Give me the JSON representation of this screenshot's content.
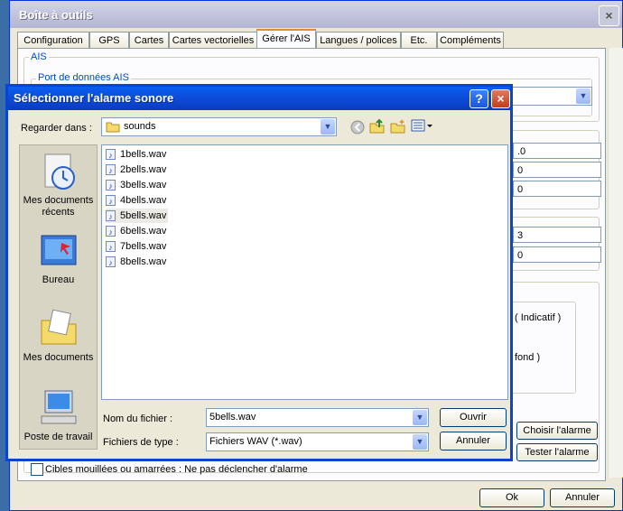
{
  "toolbox": {
    "title": "Boîte à outils",
    "close_label": "×",
    "tabs": [
      "Configuration",
      "GPS",
      "Cartes",
      "Cartes vectorielles",
      "Gérer l'AIS",
      "Langues / polices",
      "Etc.",
      "Compléments"
    ],
    "active_tab": "Gérer l'AIS",
    "group_ais": "AIS",
    "group_port": "Port de données AIS",
    "values": [
      ".0",
      "0",
      "0",
      "3",
      "0"
    ],
    "indicatif_text": "( Indicatif )",
    "fond_text": "fond )",
    "choose_alarm_button": "Choisir l'alarme",
    "test_alarm_button": "Tester l'alarme",
    "moored_checkbox_label": "Cibles mouillées ou amarrées : Ne pas déclencher d'alarme",
    "ok_button": "Ok",
    "cancel_button": "Annuler"
  },
  "dialog": {
    "title": "Sélectionner l'alarme sonore",
    "help_label": "?",
    "close_label": "×",
    "look_in_label": "Regarder dans :",
    "look_in_value": "sounds",
    "places": [
      {
        "label": "Mes documents récents",
        "icon": "recent-documents-icon"
      },
      {
        "label": "Bureau",
        "icon": "desktop-icon"
      },
      {
        "label": "Mes documents",
        "icon": "my-documents-icon"
      },
      {
        "label": "Poste de travail",
        "icon": "my-computer-icon"
      }
    ],
    "files": [
      "1bells.wav",
      "2bells.wav",
      "3bells.wav",
      "4bells.wav",
      "5bells.wav",
      "6bells.wav",
      "7bells.wav",
      "8bells.wav"
    ],
    "selected_file": "5bells.wav",
    "filename_label": "Nom du fichier :",
    "filename_value": "5bells.wav",
    "filetype_label": "Fichiers de type :",
    "filetype_value": "Fichiers WAV (*.wav)",
    "open_button": "Ouvrir",
    "cancel_button": "Annuler"
  }
}
